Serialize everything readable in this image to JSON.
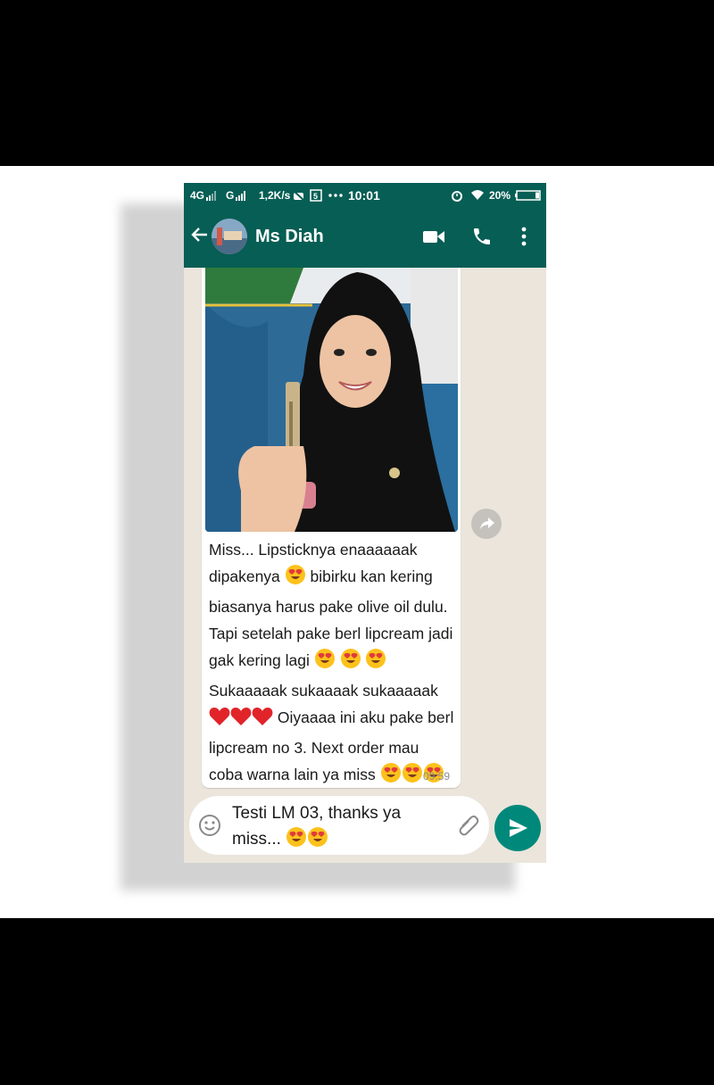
{
  "status_bar": {
    "network1": "4G",
    "network2": "G",
    "speed": "1,2K/s",
    "time": "10:01",
    "battery": "20%"
  },
  "header": {
    "contact_name": "Ms Diah",
    "back_icon": "arrow-left-icon",
    "video_icon": "video-call-icon",
    "call_icon": "phone-icon",
    "menu_icon": "more-vert-icon"
  },
  "message": {
    "segments": {
      "s1": "Miss... Lipsticknya enaaaaaak dipakenya",
      "s2": "bibirku kan kering biasanya harus pake olive oil dulu. Tapi setelah pake berl lipcream jadi gak kering lagi",
      "s3": "Sukaaaaak sukaaaak sukaaaaak",
      "s4": "Oiyaaaa ini aku pake berl lipcream no  3. Next order mau coba warna lain ya miss"
    },
    "time": "09:59"
  },
  "input": {
    "text": "Testi LM 03, thanks ya miss...",
    "emoji_icon": "smiley-icon",
    "attach_icon": "paperclip-icon",
    "send_icon": "send-icon"
  },
  "colors": {
    "header": "#075e54",
    "send_button": "#00897b",
    "chat_background": "#ebe5dc"
  }
}
